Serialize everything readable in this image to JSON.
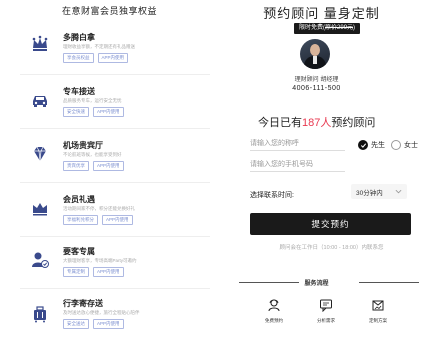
{
  "left": {
    "title": "在意财富会员独享权益",
    "benefits": [
      {
        "icon": "crown-icon-dots",
        "name": "多腾白拿",
        "desc": "理财收益享额，不定期还有礼品赠送",
        "tags": [
          "享会员权益",
          "APP内使用"
        ]
      },
      {
        "icon": "car-icon",
        "name": "专车接送",
        "desc": "品质服务专车，运行安全无忧",
        "tags": [
          "安全快速",
          "APP内使用"
        ]
      },
      {
        "icon": "diamond-icon",
        "name": "机场贵宾厅",
        "desc": "不论航班等候，也能享受到好",
        "tags": [
          "贵宾优享",
          "APP内使用"
        ]
      },
      {
        "icon": "crown-icon",
        "name": "会员礼遇",
        "desc": "活动期间家不停，积分还能兑换好礼",
        "tags": [
          "享福利兑积分",
          "APP内使用"
        ]
      },
      {
        "icon": "vip-user-icon",
        "name": "要客专属",
        "desc": "大额理财客享，专场高端Party可邀约",
        "tags": [
          "专属定制",
          "APP内使用"
        ]
      },
      {
        "icon": "luggage-icon",
        "name": "行李寄存送",
        "desc": "及时送达放心便捷，旅行全程贴心陪伴",
        "tags": [
          "安全送达",
          "APP内使用"
        ]
      }
    ]
  },
  "right": {
    "title": "预约顾问 量身定制",
    "badge_label": "限时免费",
    "badge_strike": "原价299元",
    "advisor_name": "理财顾问 胡经理",
    "advisor_phone": "4006-111-500",
    "count_prefix": "今日已有",
    "count_num": "187人",
    "count_suffix": "预约顾问",
    "name_placeholder": "请输入您的称呼",
    "phone_placeholder": "请输入您的手机号码",
    "gender_male": "先生",
    "gender_female": "女士",
    "time_label": "选择联系时间:",
    "time_value": "30分钟内",
    "submit_label": "提交预约",
    "hint": "顾问会在工作日（10:00 - 18:00）内联系您",
    "flow_title": "服务流程",
    "flow_steps": [
      {
        "icon": "consultant-icon",
        "label": "免费预约"
      },
      {
        "icon": "chat-icon",
        "label": "分析需求"
      },
      {
        "icon": "plan-icon",
        "label": "定制方案"
      }
    ],
    "accent_color": "#e8384f"
  }
}
